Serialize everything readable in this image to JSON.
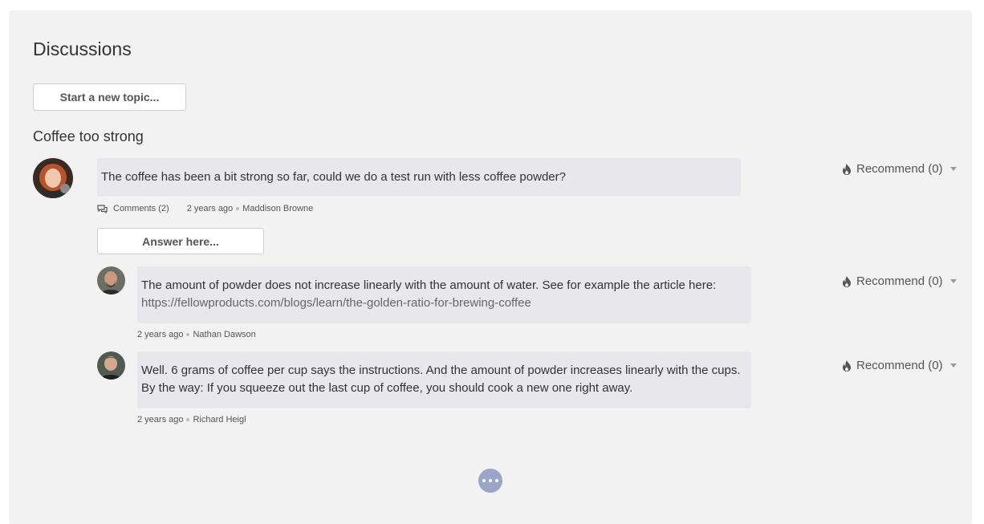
{
  "page": {
    "title": "Discussions",
    "new_topic_label": "Start a new topic..."
  },
  "topic": {
    "title": "Coffee too strong",
    "post": {
      "text": "The coffee has been a bit strong so far, could we do a test run with less coffee powder?",
      "comments_label": "Comments (2)",
      "time": "2 years ago",
      "author": "Maddison Browne",
      "recommend_label": "Recommend (0)"
    },
    "answer_placeholder": "Answer here...",
    "replies": [
      {
        "text": "The amount of powder does not increase linearly with the amount of water. See for example the article here:",
        "link": "https://fellowproducts.com/blogs/learn/the-golden-ratio-for-brewing-coffee",
        "time": "2 years ago",
        "author": "Nathan Dawson",
        "recommend_label": "Recommend (0)"
      },
      {
        "text": "Well. 6 grams of coffee per cup says the instructions. And the amount of powder increases linearly with the cups. By the way: If you squeeze out the last cup of coffee, you should cook a new one right away.",
        "time": "2 years ago",
        "author": "Richard Heigl",
        "recommend_label": "Recommend (0)"
      }
    ]
  },
  "colors": {
    "panel_bg": "#f2f2f2",
    "bubble_bg": "#e8e8ec",
    "more_button": "#9aa6c8"
  },
  "icons": [
    "flame-icon",
    "comments-icon",
    "caret-down-icon",
    "more-dots-icon"
  ]
}
